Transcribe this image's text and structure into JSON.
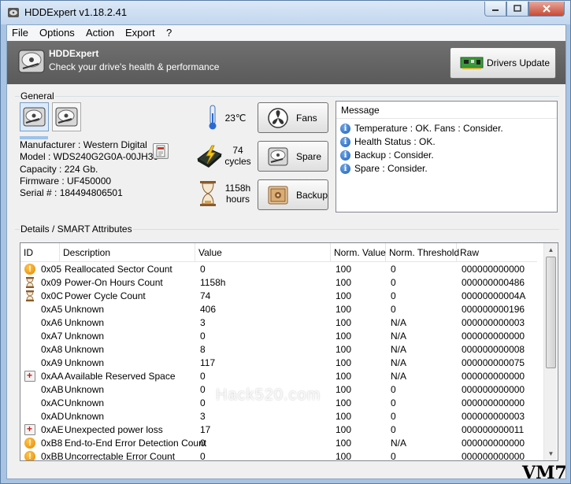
{
  "window": {
    "title": "HDDExpert v1.18.2.41"
  },
  "menu": [
    "File",
    "Options",
    "Action",
    "Export",
    "?"
  ],
  "banner": {
    "title": "HDDExpert",
    "subtitle": "Check your drive's health & performance",
    "drivers_button": "Drivers Update"
  },
  "general": {
    "label": "General",
    "manufacturer": "Manufacturer : Western Digital",
    "model": "Model : WDS240G2G0A-00JH30",
    "capacity": "Capacity : 224 Gb.",
    "firmware": "Firmware : UF450000",
    "serial": "Serial # : 184494806501"
  },
  "stats": {
    "temperature": "23℃",
    "cycles_value": "74",
    "cycles_unit": "cycles",
    "hours_value": "1158h",
    "hours_unit": "hours"
  },
  "buttons": {
    "fans": "Fans",
    "spare": "Spare",
    "backup": "Backup"
  },
  "messages": {
    "header": "Message",
    "items": [
      "Temperature : OK. Fans : Consider.",
      "Health Status : OK.",
      "Backup : Consider.",
      "Spare : Consider."
    ]
  },
  "details": {
    "label": "Details / SMART Attributes",
    "columns": [
      "ID",
      "Description",
      "Value",
      "Norm. Value",
      "Norm. Threshold",
      "Raw"
    ],
    "rows": [
      {
        "icon": "warning",
        "id": "0x05",
        "desc": "Reallocated Sector Count",
        "value": "0",
        "norm": "100",
        "thr": "0",
        "raw": "000000000000"
      },
      {
        "icon": "hourglass",
        "id": "0x09",
        "desc": "Power-On Hours Count",
        "value": "1158h",
        "norm": "100",
        "thr": "0",
        "raw": "000000000486"
      },
      {
        "icon": "hourglass",
        "id": "0x0C",
        "desc": "Power Cycle Count",
        "value": "74",
        "norm": "100",
        "thr": "0",
        "raw": "00000000004A"
      },
      {
        "icon": "",
        "id": "0xA5",
        "desc": "Unknown",
        "value": "406",
        "norm": "100",
        "thr": "0",
        "raw": "000000000196"
      },
      {
        "icon": "",
        "id": "0xA6",
        "desc": "Unknown",
        "value": "3",
        "norm": "100",
        "thr": "N/A",
        "raw": "000000000003"
      },
      {
        "icon": "",
        "id": "0xA7",
        "desc": "Unknown",
        "value": "0",
        "norm": "100",
        "thr": "N/A",
        "raw": "000000000000"
      },
      {
        "icon": "",
        "id": "0xA8",
        "desc": "Unknown",
        "value": "8",
        "norm": "100",
        "thr": "N/A",
        "raw": "000000000008"
      },
      {
        "icon": "",
        "id": "0xA9",
        "desc": "Unknown",
        "value": "117",
        "norm": "100",
        "thr": "N/A",
        "raw": "000000000075"
      },
      {
        "icon": "kit",
        "id": "0xAA",
        "desc": "Available Reserved Space",
        "value": "0",
        "norm": "100",
        "thr": "N/A",
        "raw": "000000000000"
      },
      {
        "icon": "",
        "id": "0xAB",
        "desc": "Unknown",
        "value": "0",
        "norm": "100",
        "thr": "0",
        "raw": "000000000000"
      },
      {
        "icon": "",
        "id": "0xAC",
        "desc": "Unknown",
        "value": "0",
        "norm": "100",
        "thr": "0",
        "raw": "000000000000"
      },
      {
        "icon": "",
        "id": "0xAD",
        "desc": "Unknown",
        "value": "3",
        "norm": "100",
        "thr": "0",
        "raw": "000000000003"
      },
      {
        "icon": "kit",
        "id": "0xAE",
        "desc": "Unexpected power loss",
        "value": "17",
        "norm": "100",
        "thr": "0",
        "raw": "000000000011"
      },
      {
        "icon": "warning",
        "id": "0xB8",
        "desc": "End-to-End Error Detection Count",
        "value": "0",
        "norm": "100",
        "thr": "N/A",
        "raw": "000000000000"
      },
      {
        "icon": "warning",
        "id": "0xBB",
        "desc": "Uncorrectable Error Count",
        "value": "0",
        "norm": "100",
        "thr": "0",
        "raw": "000000000000"
      }
    ]
  },
  "watermark": "Hack520.com",
  "corner_mark": "VM7"
}
